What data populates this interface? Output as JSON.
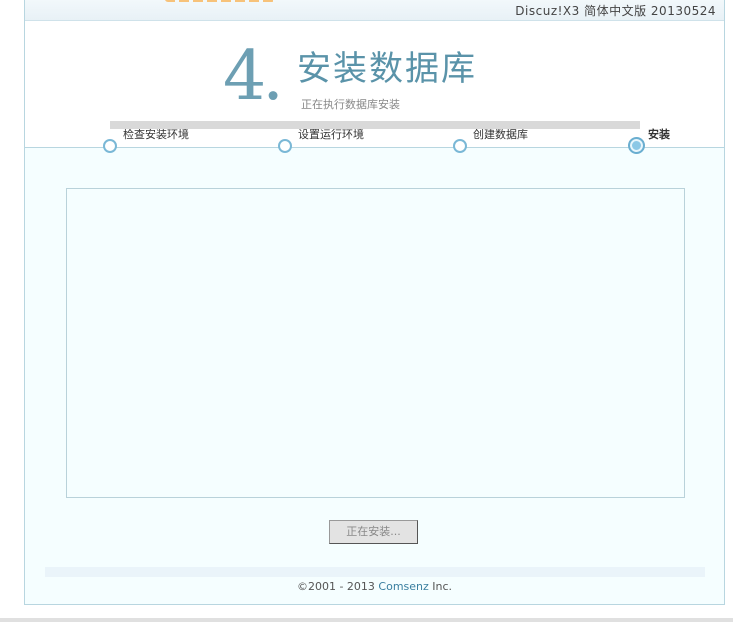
{
  "header": {
    "version": "Discuz!X3 简体中文版 20130524"
  },
  "step": {
    "number": "4.",
    "title": "安装数据库",
    "subtitle": "正在执行数据库安装"
  },
  "progress": {
    "steps": [
      {
        "label": "检查安装环境",
        "state": "done"
      },
      {
        "label": "设置运行环境",
        "state": "done"
      },
      {
        "label": "创建数据库",
        "state": "done"
      },
      {
        "label": "安装",
        "state": "current"
      }
    ]
  },
  "action": {
    "button_label": "正在安装..."
  },
  "footer": {
    "copyright": "©2001 - 2013 ",
    "company": "Comsenz",
    "suffix": " Inc."
  },
  "colors": {
    "accent": "#5a93a9",
    "brand_orange": "#f08a1c"
  }
}
